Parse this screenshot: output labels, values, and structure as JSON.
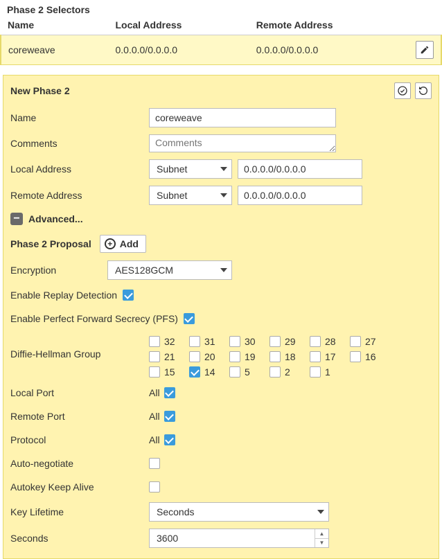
{
  "selectors": {
    "title": "Phase 2 Selectors",
    "columns": {
      "name": "Name",
      "local": "Local Address",
      "remote": "Remote Address"
    },
    "rows": [
      {
        "name": "coreweave",
        "local": "0.0.0.0/0.0.0.0",
        "remote": "0.0.0.0/0.0.0.0"
      }
    ]
  },
  "panel": {
    "title": "New Phase 2",
    "labels": {
      "name": "Name",
      "comments": "Comments",
      "local_address": "Local Address",
      "remote_address": "Remote Address",
      "advanced": "Advanced...",
      "proposal": "Phase 2 Proposal",
      "add": "Add",
      "encryption": "Encryption",
      "replay": "Enable Replay Detection",
      "pfs": "Enable Perfect Forward Secrecy (PFS)",
      "dh": "Diffie-Hellman Group",
      "local_port": "Local Port",
      "remote_port": "Remote Port",
      "protocol": "Protocol",
      "all": "All",
      "auto_negotiate": "Auto-negotiate",
      "autokey": "Autokey Keep Alive",
      "key_lifetime": "Key Lifetime",
      "seconds_label": "Seconds"
    },
    "values": {
      "name": "coreweave",
      "comments_placeholder": "Comments",
      "local_addr_type": "Subnet",
      "local_addr_value": "0.0.0.0/0.0.0.0",
      "remote_addr_type": "Subnet",
      "remote_addr_value": "0.0.0.0/0.0.0.0",
      "encryption": "AES128GCM",
      "replay_checked": true,
      "pfs_checked": true,
      "local_port_all": true,
      "remote_port_all": true,
      "protocol_all": true,
      "auto_negotiate": false,
      "autokey": false,
      "key_lifetime_unit": "Seconds",
      "seconds_value": "3600"
    },
    "dh_groups": [
      {
        "label": "32",
        "checked": false
      },
      {
        "label": "31",
        "checked": false
      },
      {
        "label": "30",
        "checked": false
      },
      {
        "label": "29",
        "checked": false
      },
      {
        "label": "28",
        "checked": false
      },
      {
        "label": "27",
        "checked": false
      },
      {
        "label": "21",
        "checked": false
      },
      {
        "label": "20",
        "checked": false
      },
      {
        "label": "19",
        "checked": false
      },
      {
        "label": "18",
        "checked": false
      },
      {
        "label": "17",
        "checked": false
      },
      {
        "label": "16",
        "checked": false
      },
      {
        "label": "15",
        "checked": false
      },
      {
        "label": "14",
        "checked": true
      },
      {
        "label": "5",
        "checked": false
      },
      {
        "label": "2",
        "checked": false
      },
      {
        "label": "1",
        "checked": false
      }
    ]
  }
}
